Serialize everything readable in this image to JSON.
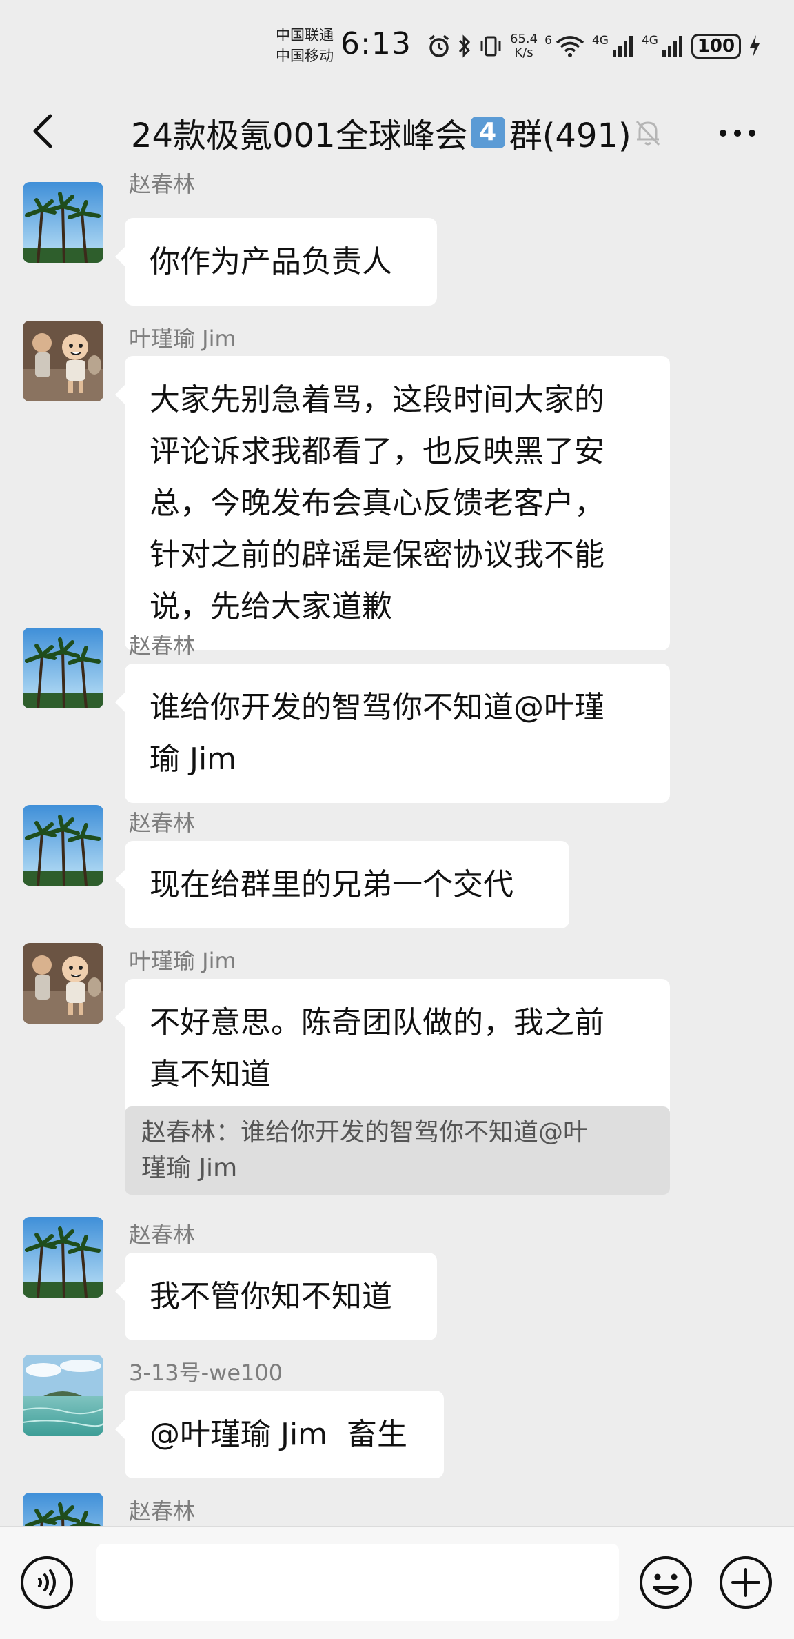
{
  "status_bar": {
    "carrier_top": "中国联通",
    "carrier_bottom": "中国移动",
    "time": "6:13",
    "net_speed_value": "65.4",
    "net_speed_unit": "K/s",
    "wifi_label": "6",
    "signal1_label": "4G",
    "signal2_label": "4G",
    "battery": "100"
  },
  "header": {
    "title_prefix": "24款极氪001全球峰会",
    "title_emoji": "4",
    "title_suffix": "群(491)"
  },
  "messages": [
    {
      "sender": "赵春林",
      "avatar": "palm-trees",
      "lines": [
        "你作为产品负责人"
      ]
    },
    {
      "sender": "叶瑾瑜 Jim",
      "avatar": "cartoon-kids",
      "lines": [
        "大家先别急着骂，这段时间大家的",
        "评论诉求我都看了，也反映黑了安",
        "总，今晚发布会真心反馈老客户，",
        "针对之前的辟谣是保密协议我不能",
        "说，先给大家道歉"
      ]
    },
    {
      "sender": "赵春林",
      "avatar": "palm-trees",
      "lines": [
        "谁给你开发的智驾你不知道@叶瑾",
        "瑜 Jim"
      ]
    },
    {
      "sender": "赵春林",
      "avatar": "palm-trees",
      "lines": [
        "现在给群里的兄弟一个交代"
      ]
    },
    {
      "sender": "叶瑾瑜 Jim",
      "avatar": "cartoon-kids",
      "lines": [
        "不好意思。陈奇团队做的，我之前",
        "真不知道"
      ],
      "quote": [
        "赵春林：谁给你开发的智驾你不知道@叶",
        "瑾瑜 Jim"
      ]
    },
    {
      "sender": "赵春林",
      "avatar": "palm-trees",
      "lines": [
        "我不管你知不知道"
      ]
    },
    {
      "sender": "3-13号-we100",
      "avatar": "sea-island",
      "lines": [
        "@叶瑾瑜 Jim  畜生"
      ]
    },
    {
      "sender": "赵春林",
      "avatar": "palm-trees",
      "lines": []
    }
  ],
  "input": {
    "placeholder": ""
  }
}
